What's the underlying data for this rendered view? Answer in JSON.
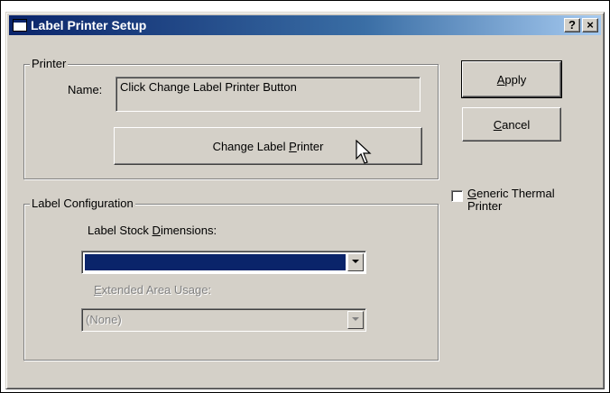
{
  "window": {
    "title": "Label Printer Setup",
    "help_label": "?",
    "close_label": "×"
  },
  "printer_group": {
    "legend": "Printer",
    "name_label": "Name:",
    "name_value": "Click Change Label Printer Button",
    "change_button": {
      "before": "Change Label ",
      "mnemonic": "P",
      "after": "rinter"
    }
  },
  "label_config": {
    "legend": "Label Configuration",
    "stock_label": {
      "before": "Label Stock ",
      "mnemonic": "D",
      "after": "imensions:"
    },
    "stock_value": "",
    "extended_label": {
      "before": "",
      "mnemonic": "E",
      "after": "xtended Area Usage:"
    },
    "extended_value": "(None)"
  },
  "buttons": {
    "apply": {
      "mnemonic": "A",
      "after": "pply"
    },
    "cancel": {
      "mnemonic": "C",
      "after": "ancel"
    }
  },
  "generic_thermal": {
    "checked": false,
    "line1": {
      "mnemonic": "G",
      "after": "eneric Thermal"
    },
    "line2": "Printer"
  }
}
